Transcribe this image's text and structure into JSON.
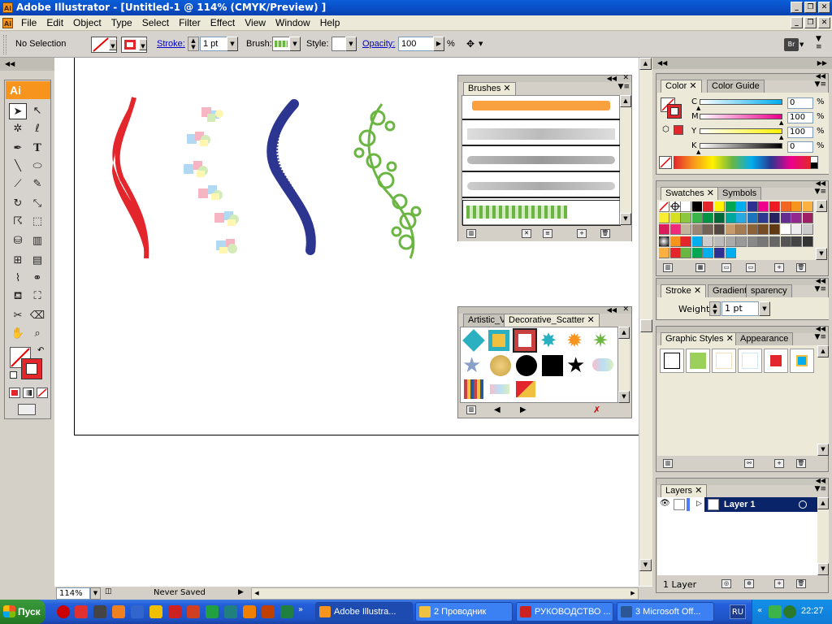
{
  "window": {
    "title": "Adobe Illustrator - [Untitled-1 @ 114% (CMYK/Preview) ]",
    "app_icon": "Ai"
  },
  "menu": [
    "File",
    "Edit",
    "Object",
    "Type",
    "Select",
    "Filter",
    "Effect",
    "View",
    "Window",
    "Help"
  ],
  "control": {
    "selection": "No Selection",
    "stroke_label": "Stroke:",
    "stroke_value": "1 pt",
    "brush_label": "Brush:",
    "style_label": "Style:",
    "opacity_label": "Opacity:",
    "opacity_value": "100",
    "percent": "%",
    "bridge": "Br"
  },
  "tools": {
    "logo": "Ai"
  },
  "panels": {
    "brushes": {
      "tab": "Brushes"
    },
    "symbols_lib": {
      "tab1": "Artistic_V",
      "tab2": "Decorative_Scatter"
    },
    "color": {
      "tab1": "Color",
      "tab2": "Color Guide",
      "channels": [
        {
          "label": "C",
          "value": "0",
          "unit": "%",
          "color": "#00aeef"
        },
        {
          "label": "M",
          "value": "100",
          "unit": "%",
          "color": "#ec008c"
        },
        {
          "label": "Y",
          "value": "100",
          "unit": "%",
          "color": "#fff200"
        },
        {
          "label": "K",
          "value": "0",
          "unit": "%",
          "color": "#000000"
        }
      ]
    },
    "swatches": {
      "tab1": "Swatches",
      "tab2": "Symbols"
    },
    "stroke": {
      "tab1": "Stroke",
      "tab2": "Gradient",
      "tab3": "sparency",
      "weight_label": "Weight:",
      "weight_value": "1 pt"
    },
    "graphic_styles": {
      "tab1": "Graphic Styles",
      "tab2": "Appearance"
    },
    "layers": {
      "tab": "Layers",
      "layer_name": "Layer 1",
      "count": "1 Layer"
    }
  },
  "status": {
    "zoom": "114%",
    "state": "Never Saved"
  },
  "taskbar": {
    "start": "Пуск",
    "items": [
      {
        "label": "Adobe Illustra...",
        "color": "#f7941d",
        "active": true
      },
      {
        "label": "2 Проводник",
        "color": "#f0c040",
        "active": false
      },
      {
        "label": "РУКОВОДСТВО ...",
        "color": "#cc2222",
        "active": false
      },
      {
        "label": "3 Microsoft Off...",
        "color": "#2b5797",
        "active": false
      }
    ],
    "lang": "RU",
    "time": "22:27"
  },
  "colors": {
    "accent": "#f7941d",
    "red_ribbon": "#e2262c",
    "blue_stroke": "#2c3590",
    "green_ornament": "#6bb543"
  }
}
